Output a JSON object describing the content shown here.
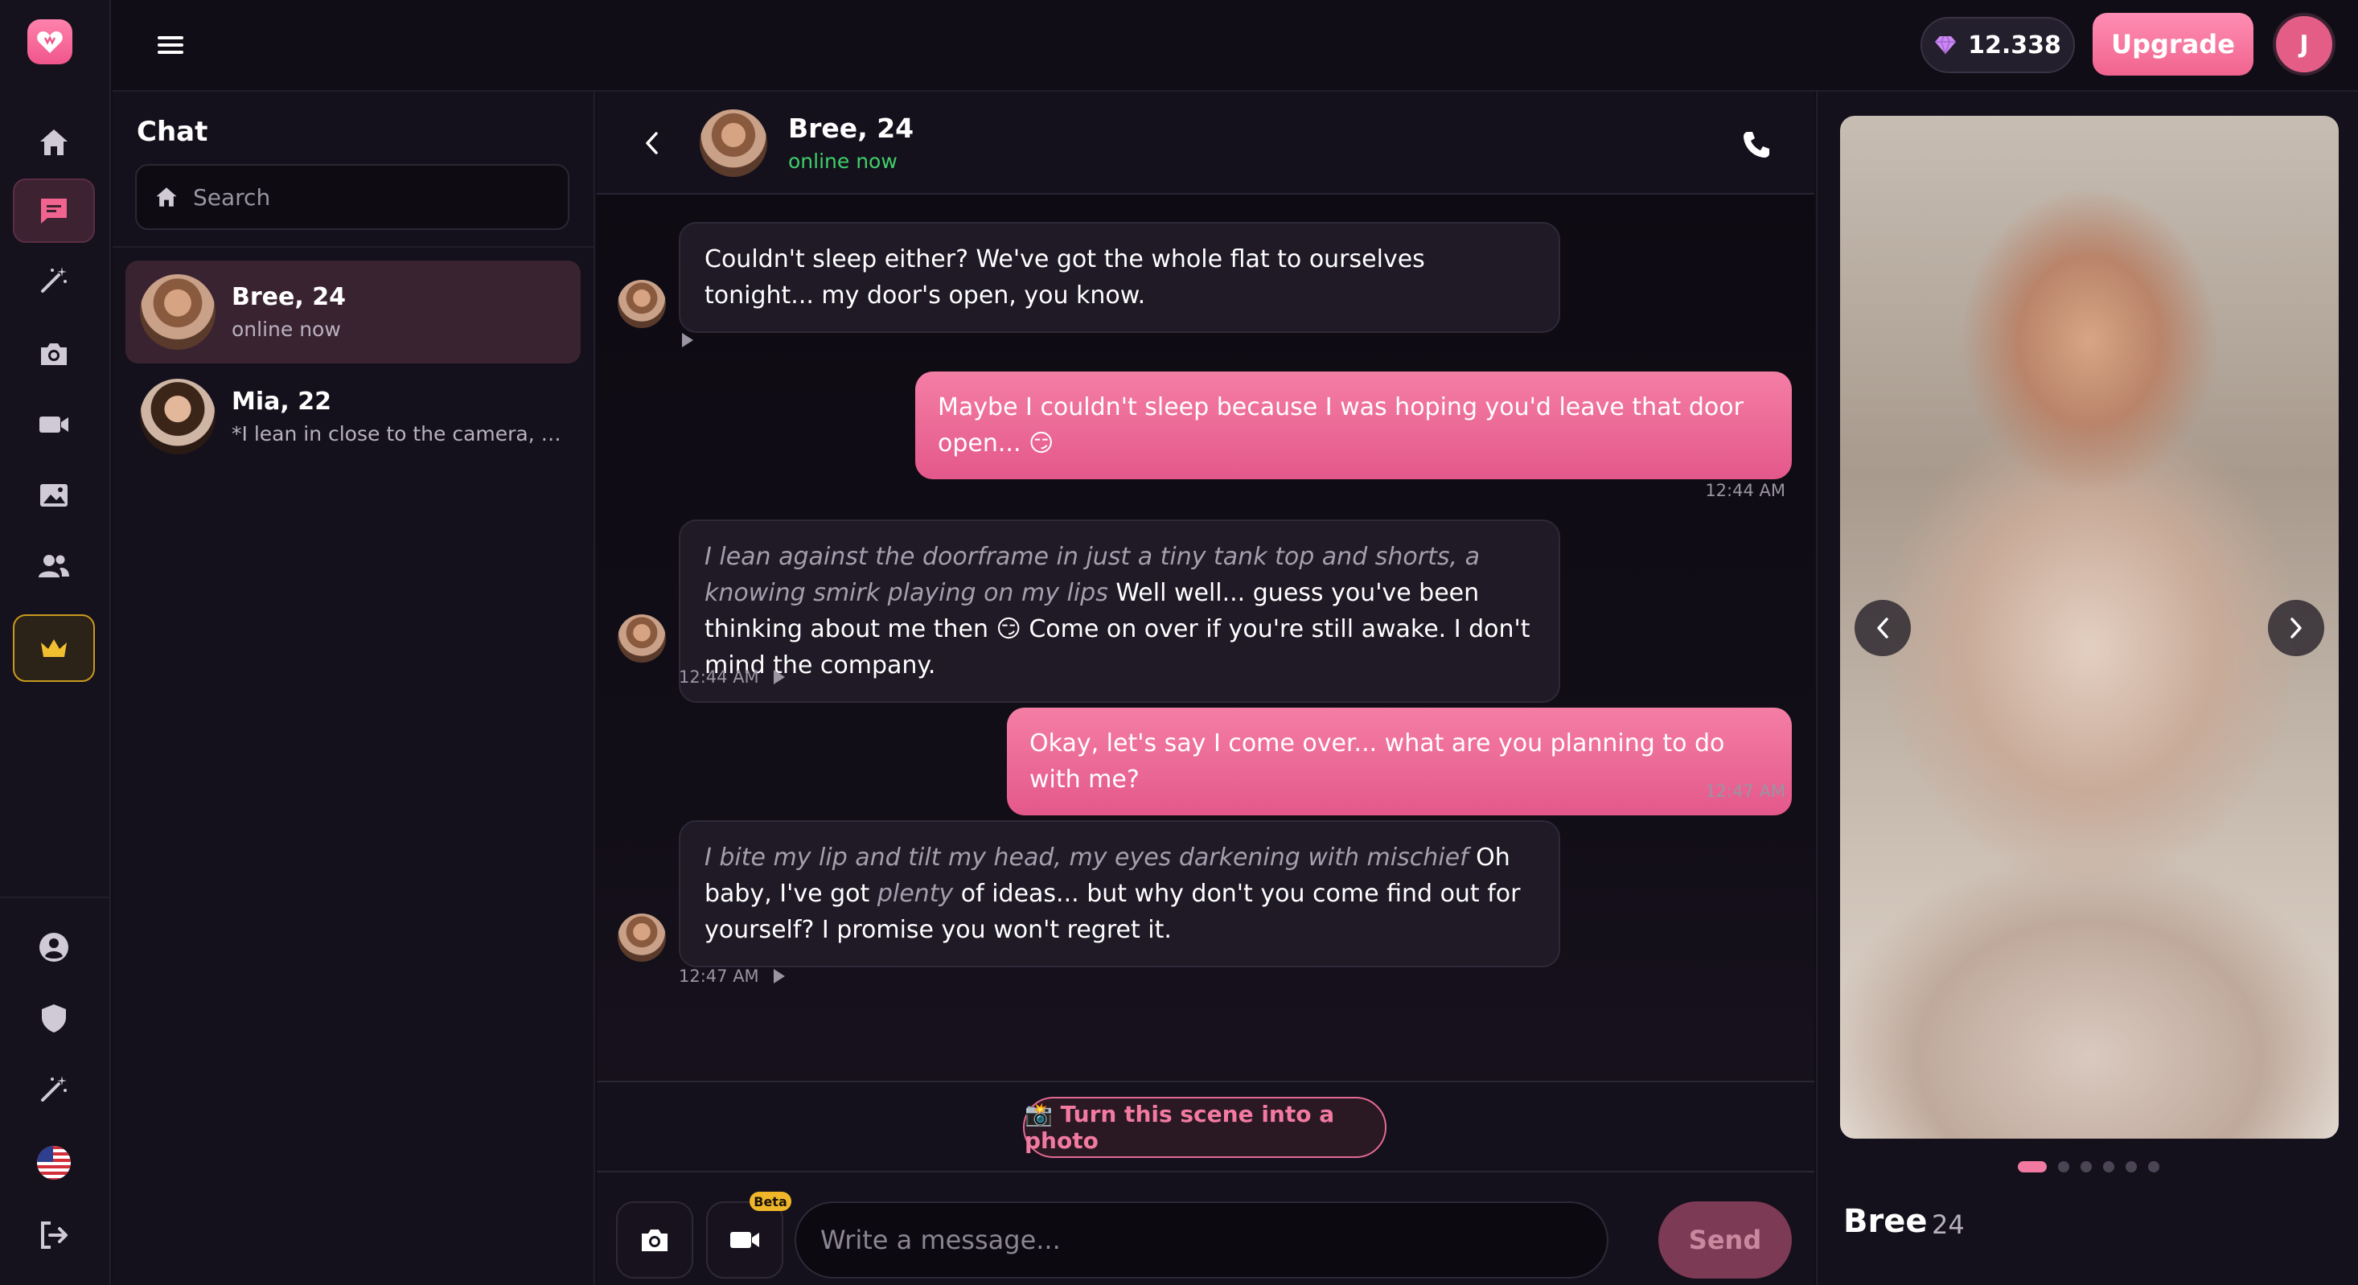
{
  "topbar": {
    "gems": "12.338",
    "upgrade_label": "Upgrade",
    "avatar_initial": "J"
  },
  "sidebar": {
    "items": [
      {
        "icon": "home-icon",
        "active": false
      },
      {
        "icon": "chat-icon",
        "active": true
      },
      {
        "icon": "magic-wand-icon",
        "active": false
      },
      {
        "icon": "camera-icon",
        "active": false
      },
      {
        "icon": "video-icon",
        "active": false
      },
      {
        "icon": "image-icon",
        "active": false
      },
      {
        "icon": "users-icon",
        "active": false
      },
      {
        "icon": "crown-icon",
        "active": false
      }
    ],
    "bottom_items": [
      {
        "icon": "account-icon"
      },
      {
        "icon": "shield-icon"
      },
      {
        "icon": "magic-wand-icon"
      },
      {
        "icon": "us-flag-icon"
      },
      {
        "icon": "logout-icon"
      }
    ]
  },
  "chat_list": {
    "title": "Chat",
    "search_placeholder": "Search",
    "conversations": [
      {
        "name": "Bree, 24",
        "subtitle": "online now",
        "active": true
      },
      {
        "name": "Mia, 22",
        "subtitle": "*I lean in close to the camera, giv...",
        "active": false
      }
    ]
  },
  "chat": {
    "name": "Bree, 24",
    "status": "online now",
    "messages": [
      {
        "from": "bot",
        "action": "",
        "text": "Couldn't sleep either? We've got the whole flat to ourselves tonight... my door's open, you know.",
        "time": ""
      },
      {
        "from": "user",
        "text": "Maybe I couldn't sleep because I was hoping you'd leave that door open... 😏",
        "time": "12:44 AM"
      },
      {
        "from": "bot",
        "action": "I lean against the doorframe in just a tiny tank top and shorts, a knowing smirk playing on my lips",
        "text": " Well well... guess you've been thinking about me then 😏 Come on over if you're still awake. I don't mind the company.",
        "time": "12:44 AM"
      },
      {
        "from": "user",
        "text": "Okay, let's say I come over... what are you planning to do with me?",
        "time": "12:47 AM"
      },
      {
        "from": "bot",
        "action": "I bite my lip and tilt my head, my eyes darkening with mischief",
        "text_a": " Oh baby, I've got ",
        "emph": "plenty",
        "text_b": " of ideas... but why don't you come find out for yourself? I promise you won't regret it.",
        "time": "12:47 AM"
      }
    ],
    "scene_button": "📸 Turn this scene into a photo",
    "beta_label": "Beta",
    "input_placeholder": "Write a message...",
    "send_label": "Send"
  },
  "profile": {
    "name": "Bree",
    "age": "24",
    "photo_count": 6,
    "photo_index": 1
  },
  "colors": {
    "accent": "#f27aa1",
    "online": "#3fcf6a",
    "premium": "#f0c030"
  }
}
